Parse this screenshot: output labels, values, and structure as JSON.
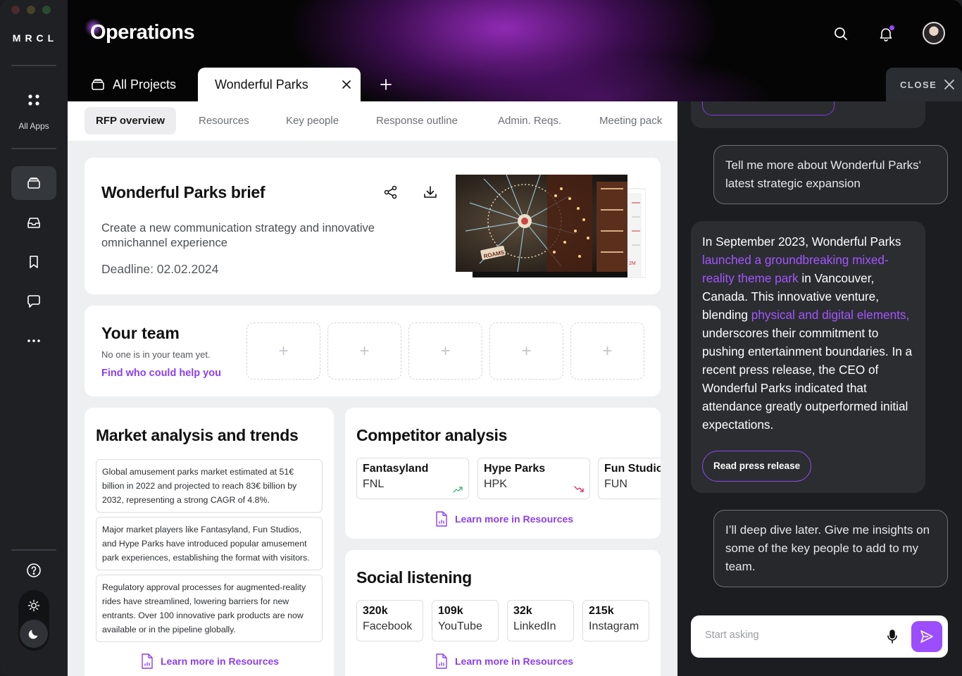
{
  "app": {
    "logo": "MRCL",
    "title": "Operations"
  },
  "sidebar": {
    "all_apps_label": "All Apps",
    "items": [
      {
        "icon": "apps-grid-icon"
      },
      {
        "icon": "projects-stack-icon"
      },
      {
        "icon": "inbox-icon"
      },
      {
        "icon": "bookmark-icon"
      },
      {
        "icon": "chat-icon"
      },
      {
        "icon": "more-icon"
      }
    ],
    "help_icon": "help-icon",
    "theme": {
      "light": "sun-icon",
      "dark": "moon-icon",
      "selected": "dark"
    }
  },
  "header": {
    "tabs": [
      {
        "label": "All Projects"
      },
      {
        "label": "Wonderful Parks",
        "active": true
      }
    ],
    "close_label": "CLOSE"
  },
  "subtabs": [
    {
      "label": "RFP overview",
      "active": true
    },
    {
      "label": "Resources"
    },
    {
      "label": "Key people"
    },
    {
      "label": "Response outline"
    },
    {
      "label": "Admin. Reqs."
    },
    {
      "label": "Meeting pack"
    }
  ],
  "brief": {
    "title": "Wonderful Parks brief",
    "description": "Create a new communication strategy and innovative omnichannel experience",
    "deadline": "Deadline: 02.02.2024",
    "image_sign": "ROAMS",
    "image_note": "2M"
  },
  "team": {
    "title": "Your team",
    "empty_text": "No one is in your team yet.",
    "link": "Find who could help you",
    "slot_label": "+"
  },
  "market": {
    "title": "Market analysis and trends",
    "items": [
      "Global amusement parks market estimated at 51€ billion in 2022 and projected to reach 83€ billion by 2032, representing a strong CAGR of 4.8%.",
      "Major market players like Fantasyland, Fun Studios, and Hype Parks have introduced popular amusement park experiences, establishing the format with visitors.",
      "Regulatory approval processes for augmented-reality rides have streamlined, lowering barriers for new entrants. Over 100 innovative park products are now available or in the pipeline globally."
    ],
    "learn_more": "Learn more in Resources"
  },
  "competitors": {
    "title": "Competitor analysis",
    "items": [
      {
        "name": "Fantasyland",
        "code": "FNL",
        "trend": "up"
      },
      {
        "name": "Hype Parks",
        "code": "HPK",
        "trend": "down"
      },
      {
        "name": "Fun Studios",
        "code": "FUN"
      }
    ],
    "learn_more": "Learn more in Resources",
    "colors": {
      "up": "#3cb371",
      "down": "#e0245e"
    }
  },
  "social": {
    "title": "Social listening",
    "items": [
      {
        "value": "320k",
        "label": "Facebook"
      },
      {
        "value": "109k",
        "label": "YouTube"
      },
      {
        "value": "32k",
        "label": "LinkedIn"
      },
      {
        "value": "215k",
        "label": "Instagram"
      }
    ],
    "learn_more": "Learn more in Resources"
  },
  "chat": {
    "user_msg_1": "Tell me more about Wonderful Parks' latest strategic expansion",
    "ai_msg": {
      "p1": "In September 2023, Wonderful Parks ",
      "link1": "launched a groundbreaking mixed-reality theme park",
      "p2": " in Vancouver, Canada. This innovative venture, blending ",
      "link2": "physical and digital elements,",
      "p3": " underscores their commitment to pushing entertainment boundaries. In a recent press release, the CEO of Wonderful Parks indicated that attendance greatly outperformed initial expectations."
    },
    "press_button": "Read press release",
    "user_msg_2": "I’ll deep dive later. Give me insights on some of the key people to add to my team.",
    "input_placeholder": "Start asking",
    "accent": "#9b4dff"
  }
}
